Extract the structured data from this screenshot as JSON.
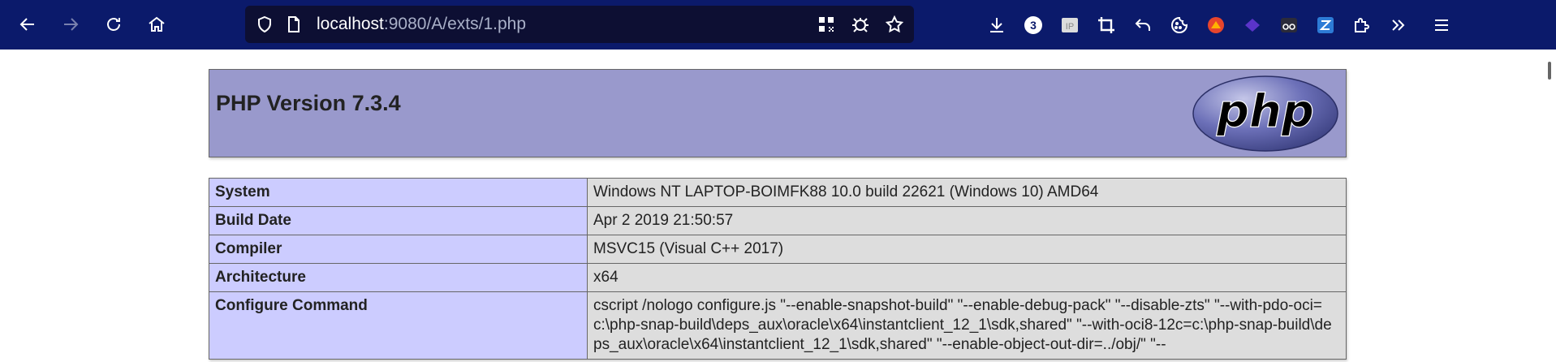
{
  "browser": {
    "url_host": "localhost",
    "url_rest": ":9080/A/exts/1.php",
    "badge_count": "3"
  },
  "header": {
    "title": "PHP Version 7.3.4",
    "logo_text": "php"
  },
  "table": {
    "rows": [
      {
        "label": "System",
        "value": "Windows NT LAPTOP-BOIMFK88 10.0 build 22621 (Windows 10) AMD64"
      },
      {
        "label": "Build Date",
        "value": "Apr 2 2019 21:50:57"
      },
      {
        "label": "Compiler",
        "value": "MSVC15 (Visual C++ 2017)"
      },
      {
        "label": "Architecture",
        "value": "x64"
      },
      {
        "label": "Configure Command",
        "value": "cscript /nologo configure.js \"--enable-snapshot-build\" \"--enable-debug-pack\" \"--disable-zts\" \"--with-pdo-oci=c:\\php-snap-build\\deps_aux\\oracle\\x64\\instantclient_12_1\\sdk,shared\" \"--with-oci8-12c=c:\\php-snap-build\\deps_aux\\oracle\\x64\\instantclient_12_1\\sdk,shared\" \"--enable-object-out-dir=../obj/\" \"--"
      }
    ]
  },
  "colors": {
    "toolbar_bg": "#0b1a6b",
    "header_bg": "#9999cc",
    "label_bg": "#ccccff",
    "value_bg": "#dddddd"
  }
}
